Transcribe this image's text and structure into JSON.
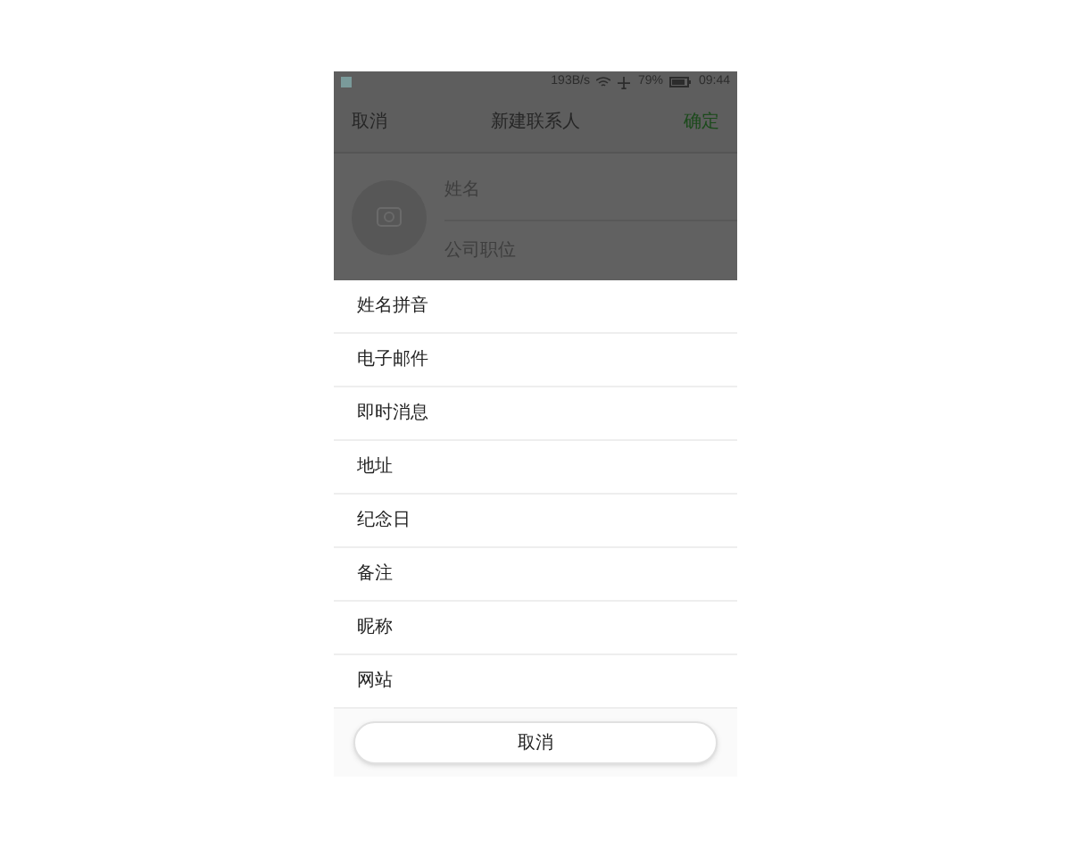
{
  "status_bar": {
    "speed": "193B/s",
    "battery": "79%",
    "time": "09:44"
  },
  "header": {
    "cancel": "取消",
    "title": "新建联系人",
    "confirm": "确定"
  },
  "form": {
    "name": {
      "placeholder": "姓名"
    },
    "company": {
      "placeholder": "公司职位"
    }
  },
  "sheet": {
    "items": [
      "姓名拼音",
      "电子邮件",
      "即时消息",
      "地址",
      "纪念日",
      "备注",
      "昵称",
      "网站"
    ],
    "cancel": "取消"
  }
}
